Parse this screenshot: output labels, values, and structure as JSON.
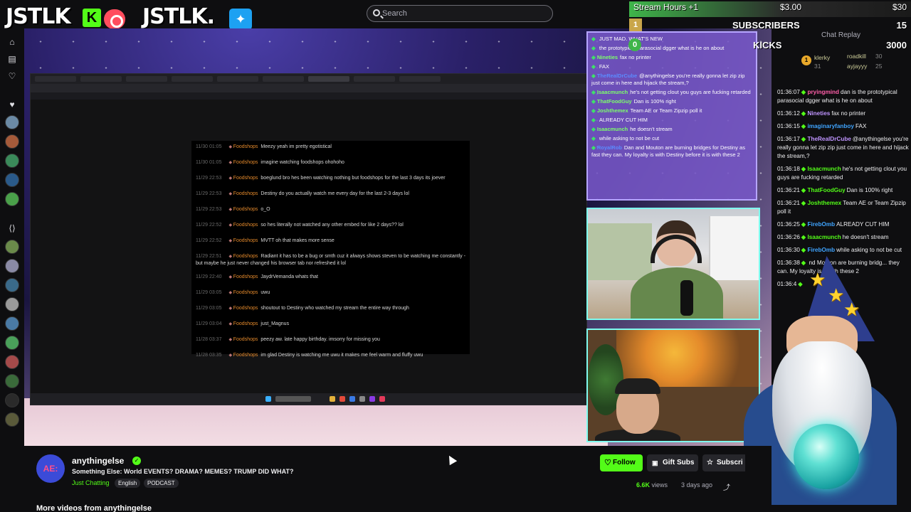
{
  "header": {
    "logo1": "JSTLK",
    "logo1_badge": "K",
    "logo2": "JSTLK.",
    "search_placeholder": "Search"
  },
  "stats": {
    "row1_label": "Stream Hours +1",
    "row1_mid": "$3.00",
    "row1_value": "$30",
    "row2_num": "1",
    "row2_label": "SUBSCRIBERS",
    "row2_value": "15",
    "row3_num": "0",
    "row3_label": "KICKS",
    "row3_value": "3000"
  },
  "screen_chat": [
    {
      "time": "11/30 01:05",
      "user": "Foodshops",
      "msg": "Meezy yeah im pretty egotistical"
    },
    {
      "time": "11/30 01:05",
      "user": "Foodshops",
      "msg": "imagine watching foodshops ohohoho"
    },
    {
      "time": "11/29 22:53",
      "user": "Foodshops",
      "msg": "boeglund bro hes been watching nothing but foodshops for the last 3 days its joever"
    },
    {
      "time": "11/29 22:53",
      "user": "Foodshops",
      "msg": "Destiny do you actually watch me every day for the last 2-3 days lol"
    },
    {
      "time": "11/29 22:53",
      "user": "Foodshops",
      "msg": "o_O"
    },
    {
      "time": "11/29 22:52",
      "user": "Foodshops",
      "msg": "so hes literally not watched any other embed for like 2 days?? lol"
    },
    {
      "time": "11/29 22:52",
      "user": "Foodshops",
      "msg": "MVTT oh that makes more sense"
    },
    {
      "time": "11/29 22:51",
      "user": "Foodshops",
      "msg": "Radiant it has to be a bug or smth cuz it always shows steven to be watching me constantly - but maybe he just never changed his browser tab nor refreshed it lol"
    },
    {
      "time": "11/29 22:40",
      "user": "Foodshops",
      "msg": "JaydrVemanda whats that"
    },
    {
      "time": "11/29 03:05",
      "user": "Foodshops",
      "msg": "uwu"
    },
    {
      "time": "11/29 03:05",
      "user": "Foodshops",
      "msg": "shoutout to Destiny who watched my stream the entire way through"
    },
    {
      "time": "11/29 03:04",
      "user": "Foodshops",
      "msg": "just_Magnus"
    },
    {
      "time": "11/28 03:37",
      "user": "Foodshops",
      "msg": "peezy aw. late happy birthday. imsorry for missing you"
    },
    {
      "time": "11/28 03:35",
      "user": "Foodshops",
      "msg": "im glad Destiny is watching me uwu it makes me feel warm and fluffy uwu"
    }
  ],
  "overlay_chat": [
    {
      "user": "",
      "msg": "JUST MAD. WHAT'S NEW"
    },
    {
      "user": "",
      "msg": "the prototypical parasocial dgger what is he on about"
    },
    {
      "user": "Nineties",
      "msg": "fax no printer"
    },
    {
      "user": "",
      "msg": "FAX"
    },
    {
      "user": "TheRealDrCube",
      "msg": "@anythingelse you're really gonna let zip zip just come in here and hijack the stream,?"
    },
    {
      "user": "Isaacmunch",
      "msg": "he's not getting clout you guys are fucking retarded"
    },
    {
      "user": "ThatFoodGuy",
      "msg": "Dan is 100% right"
    },
    {
      "user": "Joshthemex",
      "msg": "Team AE or Team Zipzip poll it"
    },
    {
      "user": "",
      "msg": "ALREADY CUT HIM"
    },
    {
      "user": "Isaacmunch",
      "msg": "he doesn't stream"
    },
    {
      "user": "",
      "msg": "while asking to not be cut"
    },
    {
      "user": "RoyalRob",
      "msg": "Dan and Mouton are burning bridges for Destiny as fast they can. My loyalty is with Destiny before it is with these 2"
    }
  ],
  "chat_right": {
    "replay_label": "Chat Replay",
    "gifters": [
      {
        "name": "klerky",
        "count": ""
      },
      {
        "name": "roadkill",
        "count": "30"
      },
      {
        "name": "",
        "count": "31"
      },
      {
        "name": "ayjayyy",
        "count": "25"
      }
    ],
    "gift_coin": "1",
    "messages": [
      {
        "time": "01:36:07",
        "user": "pryingmind",
        "cls": "pink",
        "msg": "dan is the prototypical parasocial dgger what is he on about"
      },
      {
        "time": "01:36:12",
        "user": "Nineties",
        "cls": "purple",
        "msg": "fax no printer"
      },
      {
        "time": "01:36:15",
        "user": "imaginaryfanboy",
        "cls": "blue",
        "msg": "FAX"
      },
      {
        "time": "01:36:17",
        "user": "TheRealDrCube",
        "cls": "purple",
        "msg": "@anythingelse you're really gonna let zip zip just come in here and hijack the stream,?"
      },
      {
        "time": "01:36:18",
        "user": "Isaacmunch",
        "cls": "",
        "msg": "he's not getting clout you guys are fucking retarded"
      },
      {
        "time": "01:36:21",
        "user": "ThatFoodGuy",
        "cls": "",
        "msg": "Dan is 100% right"
      },
      {
        "time": "01:36:21",
        "user": "Joshthemex",
        "cls": "",
        "msg": "Team AE or Team Zipzip poll it"
      },
      {
        "time": "01:36:25",
        "user": "FirebOmb",
        "cls": "blue",
        "msg": "ALREADY CUT HIM"
      },
      {
        "time": "01:36:26",
        "user": "Isaacmunch",
        "cls": "",
        "msg": "he doesn't stream"
      },
      {
        "time": "01:36:30",
        "user": "FirebOmb",
        "cls": "blue",
        "msg": "while asking to not be cut"
      },
      {
        "time": "01:36:38",
        "user": "",
        "cls": "",
        "msg": "nd Mouton are burning bridg... they can. My loyalty is v... ith these 2"
      },
      {
        "time": "01:36:4",
        "user": "",
        "cls": "",
        "msg": ""
      }
    ]
  },
  "channel": {
    "avatar_text": "AE:",
    "name": "anythingelse",
    "title": "Something Else: World EVENTS? DRAMA? MEMES? TRUMP DID WHAT?",
    "category": "Just Chatting",
    "tags": [
      "English",
      "PODCAST"
    ],
    "follow_label": "Follow",
    "gift_label": "Gift Subs",
    "subscribe_label": "Subscri",
    "views_count": "6.6K",
    "views_label": "views",
    "ago": "3 days ago",
    "more_videos": "More videos from anythingelse"
  }
}
